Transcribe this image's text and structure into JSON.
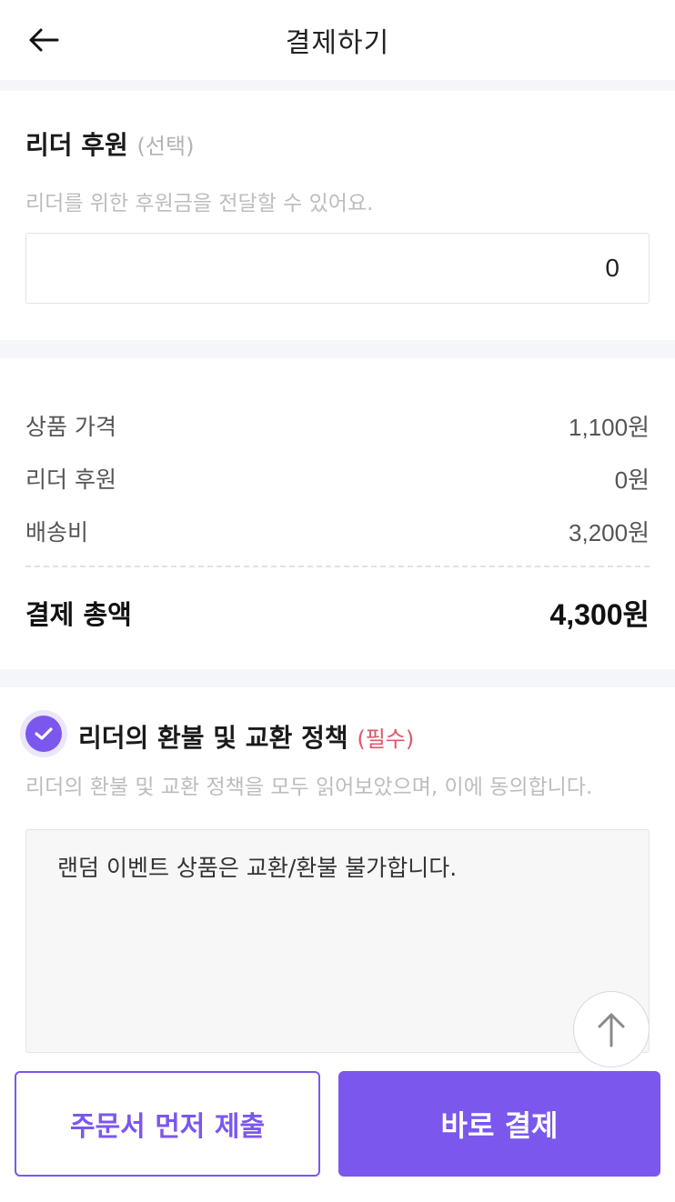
{
  "header": {
    "title": "결제하기",
    "back_icon": "arrow-left-icon"
  },
  "sponsor": {
    "title": "리더 후원",
    "optional_tag": "(선택)",
    "description": "리더를 위한 후원금을 전달할 수 있어요.",
    "amount_value": "0"
  },
  "summary": {
    "rows": [
      {
        "label": "상품 가격",
        "value": "1,100원"
      },
      {
        "label": "리더 후원",
        "value": "0원"
      },
      {
        "label": "배송비",
        "value": "3,200원"
      }
    ],
    "total_label": "결제 총액",
    "total_value": "4,300원"
  },
  "policy": {
    "title": "리더의 환불 및 교환 정책",
    "required_tag": "(필수)",
    "description": "리더의 환불 및 교환 정책을 모두 읽어보았으며, 이에 동의합니다.",
    "checked": true,
    "content": "랜덤 이벤트 상품은 교환/환불 불가합니다."
  },
  "scroll_top_icon": "arrow-up-icon",
  "actions": {
    "submit_order_label": "주문서 먼저 제출",
    "pay_now_label": "바로 결제"
  },
  "colors": {
    "accent": "#7b57ee",
    "required": "#e0566a",
    "section_gap": "#f5f6fa"
  }
}
